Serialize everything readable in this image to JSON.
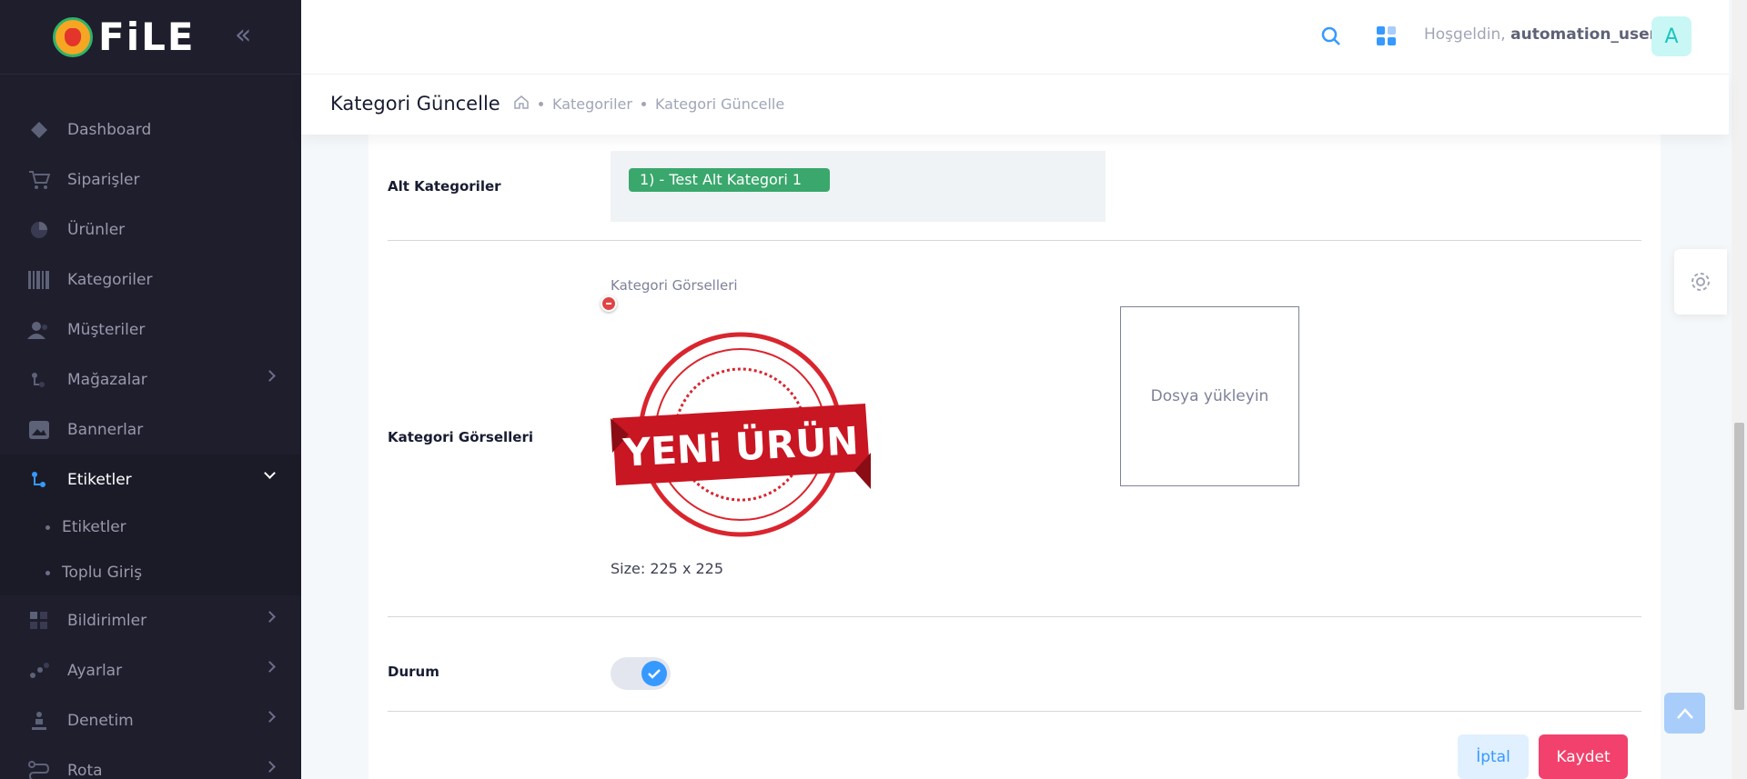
{
  "sidebar": {
    "logo_text": "FiLE",
    "items": [
      {
        "label": "Dashboard"
      },
      {
        "label": "Siparişler"
      },
      {
        "label": "Ürünler"
      },
      {
        "label": "Kategoriler"
      },
      {
        "label": "Müşteriler"
      },
      {
        "label": "Mağazalar"
      },
      {
        "label": "Bannerlar"
      },
      {
        "label": "Etiketler"
      },
      {
        "label": "Bildirimler"
      },
      {
        "label": "Ayarlar"
      },
      {
        "label": "Denetim"
      },
      {
        "label": "Rota"
      }
    ],
    "submenu": [
      {
        "label": "Etiketler"
      },
      {
        "label": "Toplu Giriş"
      }
    ]
  },
  "header": {
    "welcome": "Hoşgeldin,",
    "username": "automation_user",
    "avatar_letter": "A"
  },
  "toolbar": {
    "title": "Kategori Güncelle",
    "breadcrumb": [
      "Kategoriler",
      "Kategori Güncelle"
    ]
  },
  "form": {
    "subcategories_label": "Alt Kategoriler",
    "subcategory_tag": "1)  - Test Alt Kategori 1",
    "images_label": "Kategori Görselleri",
    "images_caption": "Kategori Görselleri",
    "image_text": "YENi ÜRÜN",
    "image_size": "Size: 225 x 225",
    "upload_text": "Dosya yükleyin",
    "status_label": "Durum",
    "status_on": true,
    "cancel_label": "İptal",
    "save_label": "Kaydet"
  },
  "colors": {
    "sidebar_bg": "#1e1e2d",
    "accent_blue": "#3699ff",
    "save_red": "#f1416c",
    "tag_green": "#3aa76d"
  }
}
